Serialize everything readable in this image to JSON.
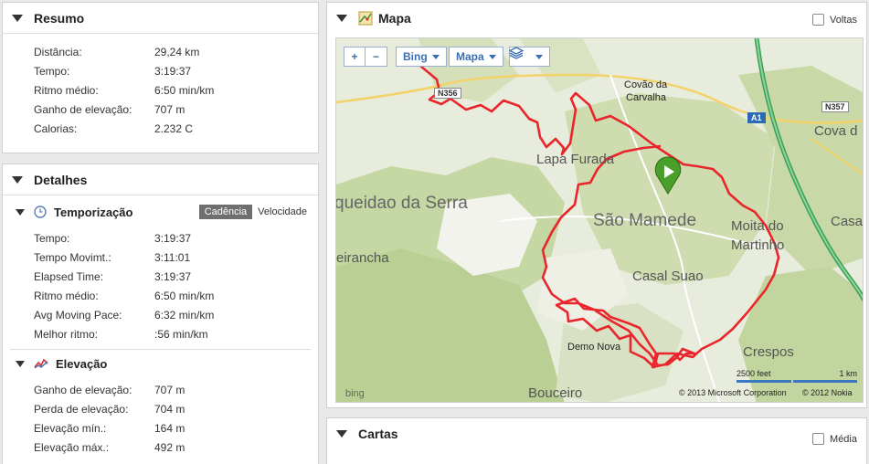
{
  "resumo": {
    "title": "Resumo",
    "rows": [
      {
        "label": "Distância:",
        "value": "29,24 km"
      },
      {
        "label": "Tempo:",
        "value": "3:19:37"
      },
      {
        "label": "Ritmo médio:",
        "value": "6:50 min/km"
      },
      {
        "label": "Ganho de elevação:",
        "value": "707 m"
      },
      {
        "label": "Calorias:",
        "value": "2.232 C"
      }
    ]
  },
  "detalhes": {
    "title": "Detalhes",
    "temporizacao": {
      "title": "Temporização",
      "tabs": [
        "Cadência",
        "Velocidade"
      ],
      "active_tab": "Cadência",
      "rows": [
        {
          "label": "Tempo:",
          "value": "3:19:37"
        },
        {
          "label": "Tempo Movimt.:",
          "value": "3:11:01"
        },
        {
          "label": "Elapsed Time:",
          "value": "3:19:37"
        },
        {
          "label": "Ritmo médio:",
          "value": "6:50 min/km"
        },
        {
          "label": "Avg Moving Pace:",
          "value": "6:32 min/km"
        },
        {
          "label": "Melhor ritmo:",
          "value": ":56 min/km"
        }
      ]
    },
    "elevacao": {
      "title": "Elevação",
      "rows": [
        {
          "label": "Ganho de elevação:",
          "value": "707 m"
        },
        {
          "label": "Perda de elevação:",
          "value": "704 m"
        },
        {
          "label": "Elevação mín.:",
          "value": "164 m"
        },
        {
          "label": "Elevação máx.:",
          "value": "492 m"
        }
      ]
    }
  },
  "mapa": {
    "title": "Mapa",
    "voltas_label": "Voltas",
    "controls": {
      "zoom_in": "+",
      "zoom_out": "−",
      "provider": "Bing",
      "type": "Mapa"
    },
    "places": {
      "lapa_furada": "Lapa Furada",
      "sao_mamede": "São Mamede",
      "covao": "Covão da",
      "carvalha": "Carvalha",
      "moita": "Moita do",
      "martinho": "Martinho",
      "casal_suao": "Casal Suao",
      "demo_nova": "Demo Nova",
      "crespos": "Crespos",
      "bouceiro": "Bouceiro",
      "queidao": "queidao da Serra",
      "eiranch": "eirancha",
      "cova": "Cova d",
      "casa": "Casa"
    },
    "roads": {
      "n356": "N356",
      "n357": "N357",
      "a1": "A1"
    },
    "scale": {
      "feet": "2500 feet",
      "km": "1 km"
    },
    "copyright_ms": "© 2013 Microsoft Corporation",
    "copyright_nokia": "© 2012 Nokia",
    "bing_logo": "bing",
    "route_color": "#e8262b"
  },
  "cartas": {
    "title": "Cartas",
    "media_label": "Média"
  }
}
